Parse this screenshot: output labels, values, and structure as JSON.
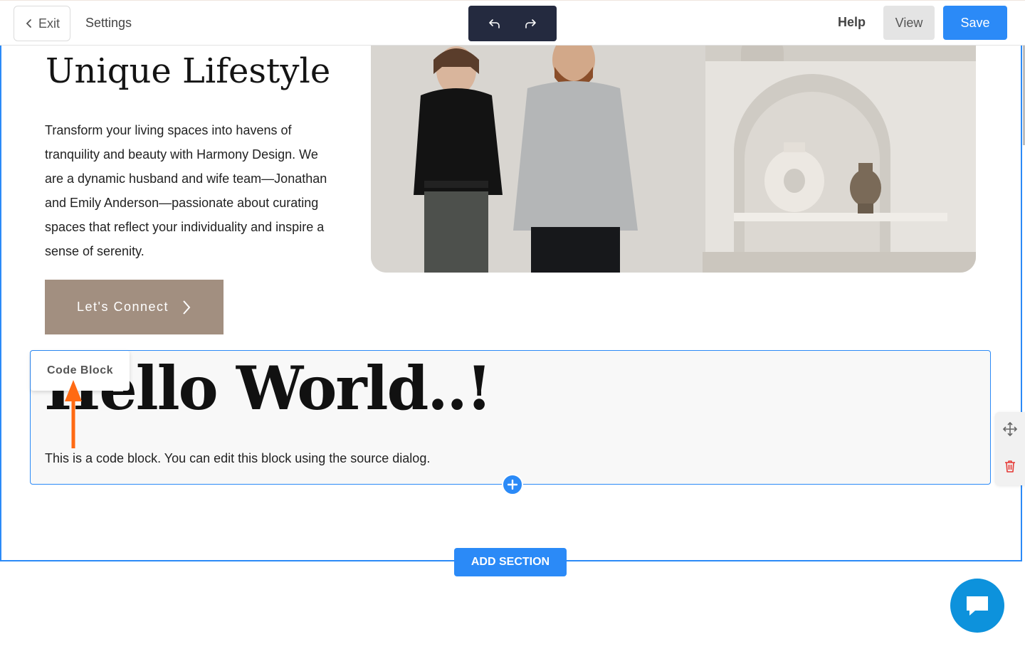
{
  "toolbar": {
    "exit_label": "Exit",
    "settings_label": "Settings",
    "help_label": "Help",
    "view_label": "View",
    "save_label": "Save",
    "undo_icon": "undo-icon",
    "redo_icon": "redo-icon"
  },
  "hero": {
    "title": "Unique Lifestyle",
    "paragraph": "Transform your living spaces into havens of tranquility and beauty with Harmony Design. We are a dynamic husband and wife team—Jonathan and Emily Anderson—passionate about curating spaces that reflect your individuality and inspire a sense of serenity.",
    "cta_label": "Let's Connect"
  },
  "code_block": {
    "label": "Code Block",
    "heading": "Hello World..!",
    "text": "This is a code block. You can edit this block using the source dialog."
  },
  "actions": {
    "add_section_label": "ADD SECTION"
  },
  "colors": {
    "accent": "#2b8af7",
    "cta": "#a28f80",
    "toolbar_dark": "#242a3f",
    "arrow": "#ff6a13",
    "chat": "#0d92dc",
    "delete": "#e53935"
  }
}
